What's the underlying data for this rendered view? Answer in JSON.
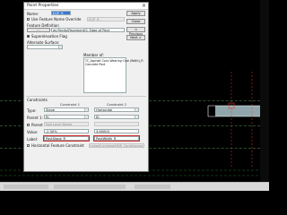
{
  "dialog": {
    "title": "Point Properties",
    "name_label": "Name:",
    "name_value": "EOP_R",
    "use_feature_name_label": "Use Feature Name Override",
    "use_feature_name_value": "EOP_R",
    "feature_definition_label": "Feature Definition",
    "feature_definition_value": "as Points\\Pavement\\S_Edge of Pavt",
    "superelevation_label": "Superelevation Flag",
    "alternate_surface_label": "Alternate Surface:",
    "member_of_label": "Member of:",
    "member_of_items": [
      "TC_Asphalt Conc Wearing Crse (Wdth)_R",
      "Concrete Pavt"
    ],
    "buttons": {
      "apply": "Apply",
      "close": "Close",
      "previous": "< Previous",
      "next": "Next >"
    },
    "constraints": {
      "section_label": "Constraints",
      "col1": "Constraint 1",
      "col2": "Constraint 2",
      "type_label": "Type:",
      "type1": "Slope",
      "type2": "Horizontal",
      "parent1_label": "Parent 1:",
      "parent1_c1": "EL",
      "parent1_c2": "EL",
      "parent2_label": "Parent 2:",
      "parent2_c1": "Null Level Name",
      "value_label": "Value:",
      "value1": "-2.50%",
      "value2": "3.60000",
      "label_label": "Label:",
      "label1": "PavtSlope_R",
      "label2": "PavtWidth_R",
      "horizontal_feature_label": "Horizontal Feature Constraint",
      "bottom_button": "Linked/Unlinked/NEW_Conditioning Use"
    }
  }
}
